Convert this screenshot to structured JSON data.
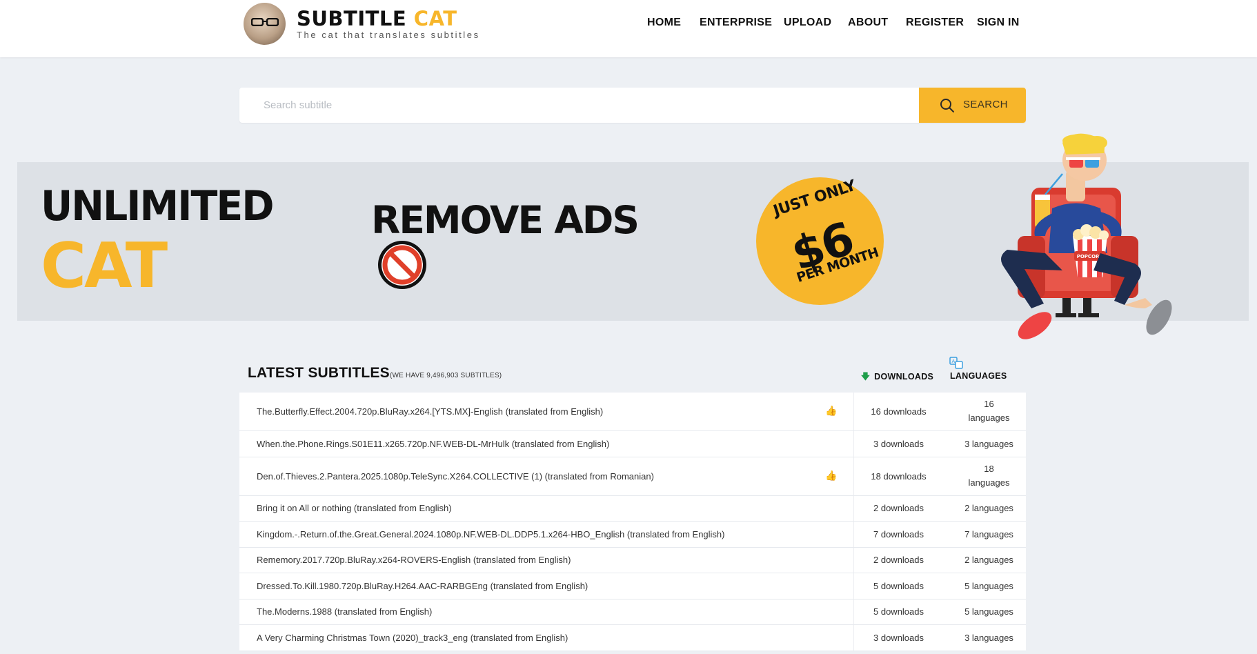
{
  "header": {
    "logo_title_main": "SUBTITLE ",
    "logo_title_accent": "CAT",
    "logo_subtitle": "The cat that translates subtitles",
    "nav": [
      "HOME",
      "ENTERPRISE",
      "UPLOAD",
      "ABOUT",
      "REGISTER",
      "SIGN IN"
    ]
  },
  "search": {
    "placeholder": "Search subtitle",
    "value": "",
    "button_label": "SEARCH"
  },
  "banner": {
    "line1": "UNLIMITED",
    "line2": "CAT",
    "remove_ads": "REMOVE ADS",
    "price_top": "JUST ONLY",
    "price_value": "$6",
    "price_bottom": "PER MONTH",
    "popcorn_label": "POPCORN"
  },
  "latest": {
    "title": "LATEST SUBTITLES",
    "count_text": "(WE HAVE 9,496,903 SUBTITLES)",
    "col_downloads": "DOWNLOADS",
    "col_languages": "LANGUAGES"
  },
  "rows": [
    {
      "name": "The.Butterfly.Effect.2004.720p.BluRay.x264.[YTS.MX]-English (translated from English)",
      "thumb": true,
      "downloads": "16 downloads",
      "languages_1": "16",
      "languages_2": "languages"
    },
    {
      "name": "When.the.Phone.Rings.S01E11.x265.720p.NF.WEB-DL-MrHulk (translated from English)",
      "thumb": false,
      "downloads": "3 downloads",
      "languages_1": "3 languages",
      "languages_2": ""
    },
    {
      "name": "Den.of.Thieves.2.Pantera.2025.1080p.TeleSync.X264.COLLECTIVE (1) (translated from Romanian)",
      "thumb": true,
      "downloads": "18 downloads",
      "languages_1": "18",
      "languages_2": "languages"
    },
    {
      "name": "Bring it on All or nothing (translated from English)",
      "thumb": false,
      "downloads": "2 downloads",
      "languages_1": "2 languages",
      "languages_2": ""
    },
    {
      "name": "Kingdom.-.Return.of.the.Great.General.2024.1080p.NF.WEB-DL.DDP5.1.x264-HBO_English (translated from English)",
      "thumb": false,
      "downloads": "7 downloads",
      "languages_1": "7 languages",
      "languages_2": ""
    },
    {
      "name": "Rememory.2017.720p.BluRay.x264-ROVERS-English (translated from English)",
      "thumb": false,
      "downloads": "2 downloads",
      "languages_1": "2 languages",
      "languages_2": ""
    },
    {
      "name": "Dressed.To.Kill.1980.720p.BluRay.H264.AAC-RARBGEng (translated from English)",
      "thumb": false,
      "downloads": "5 downloads",
      "languages_1": "5 languages",
      "languages_2": ""
    },
    {
      "name": "The.Moderns.1988 (translated from English)",
      "thumb": false,
      "downloads": "5 downloads",
      "languages_1": "5 languages",
      "languages_2": ""
    },
    {
      "name": "A Very Charming Christmas Town (2020)_track3_eng (translated from English)",
      "thumb": false,
      "downloads": "3 downloads",
      "languages_1": "3 languages",
      "languages_2": ""
    }
  ],
  "colors": {
    "accent": "#f7b62b",
    "background": "#edf0f4",
    "banner": "#dde1e6"
  },
  "icons": [
    "cat-avatar-icon",
    "search-icon",
    "no-entry-icon",
    "thumbs-up-icon",
    "download-arrow-icon",
    "translate-icon"
  ]
}
